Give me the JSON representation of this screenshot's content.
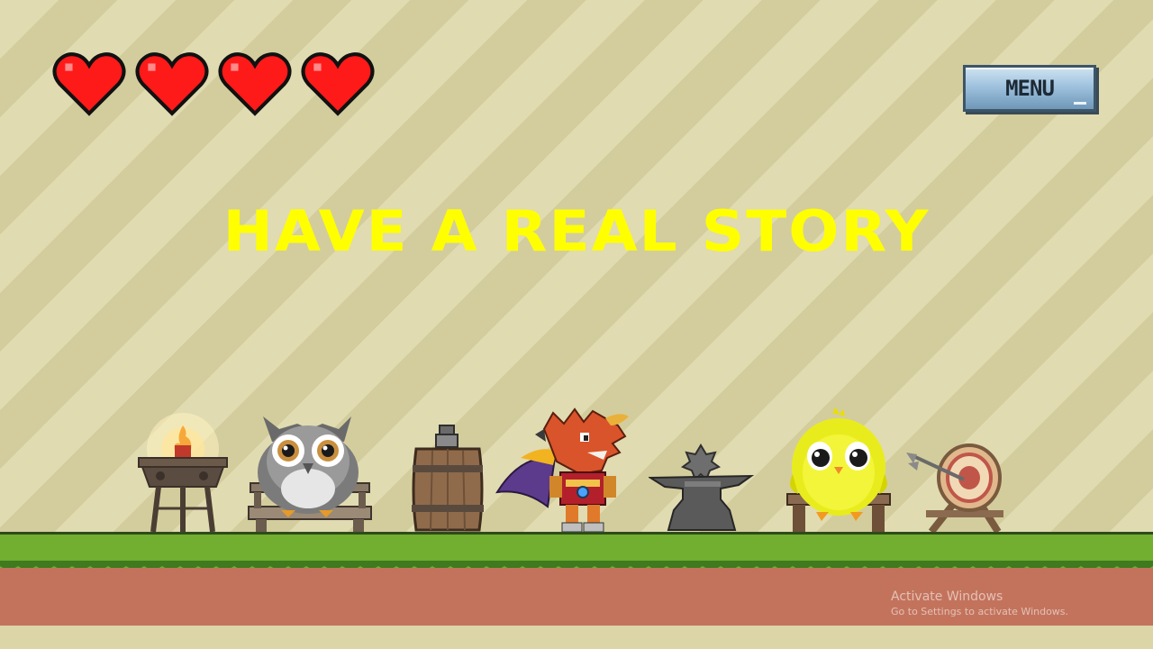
{
  "hud": {
    "hearts": [
      {
        "icon": "heart-icon",
        "state": "full"
      },
      {
        "icon": "heart-icon",
        "state": "full"
      },
      {
        "icon": "heart-icon",
        "state": "full"
      },
      {
        "icon": "heart-icon",
        "state": "full"
      }
    ],
    "heart_color": "#ff1a1a",
    "menu_label": "MENU"
  },
  "headline": "HAVE A REAL STORY",
  "headline_color": "#ffff00",
  "scene": {
    "props": [
      "torch-brazier",
      "owl-on-bench",
      "wooden-barrel",
      "dragon-knight-player",
      "anvil",
      "yellow-chick-on-bench",
      "archery-target"
    ],
    "grass_color": "#72ae2f",
    "dirt_color": "#c3735c"
  },
  "watermark": {
    "line1": "Activate Windows",
    "line2": "Go to Settings to activate Windows."
  }
}
